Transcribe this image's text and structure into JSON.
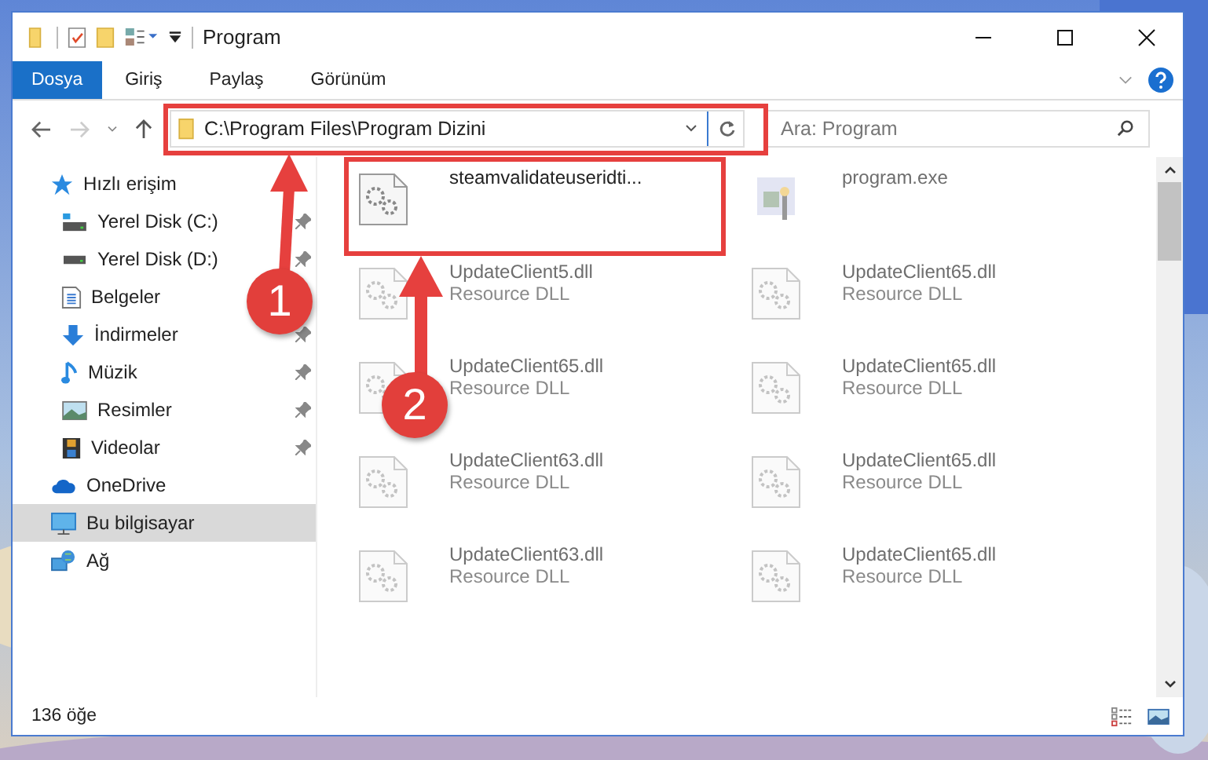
{
  "window": {
    "title": "Program"
  },
  "ribbon_tabs": [
    {
      "label": "Dosya",
      "selected": true
    },
    {
      "label": "Giriş",
      "selected": false
    },
    {
      "label": "Paylaş",
      "selected": false
    },
    {
      "label": "Görünüm",
      "selected": false
    }
  ],
  "address": {
    "path": "C:\\Program Files\\Program Dizini"
  },
  "search": {
    "placeholder": "Ara: Program"
  },
  "sidebar": {
    "items": [
      {
        "label": "Hızlı erişim",
        "selected": false,
        "children": [
          {
            "label": "Yerel Disk (C:)",
            "pinned": true
          },
          {
            "label": "Yerel Disk (D:)",
            "pinned": true
          },
          {
            "label": "Belgeler",
            "pinned": false
          },
          {
            "label": "İndirmeler",
            "pinned": true
          },
          {
            "label": "Müzik",
            "pinned": true
          },
          {
            "label": "Resimler",
            "pinned": true
          },
          {
            "label": "Videolar",
            "pinned": true
          }
        ]
      },
      {
        "label": "OneDrive",
        "selected": false
      },
      {
        "label": "Bu bilgisayar",
        "selected": true
      },
      {
        "label": "Ağ",
        "selected": false
      }
    ]
  },
  "files": [
    {
      "name": "steamvalidateuseridti...",
      "kind": "settings",
      "dimmed": false
    },
    {
      "name": "program.exe",
      "kind": "app",
      "dimmed": true
    },
    {
      "name": "UpdateClient5.dll",
      "type": "Resource DLL",
      "kind": "settings",
      "dimmed": true
    },
    {
      "name": "UpdateClient65.dll",
      "type": "Resource DLL",
      "kind": "settings",
      "dimmed": true
    },
    {
      "name": "UpdateClient65.dll",
      "type": "Resource DLL",
      "kind": "settings",
      "dimmed": true
    },
    {
      "name": "UpdateClient65.dll",
      "type": "Resource DLL",
      "kind": "settings",
      "dimmed": true
    },
    {
      "name": "UpdateClient63.dll",
      "type": "Resource DLL",
      "kind": "settings",
      "dimmed": true
    },
    {
      "name": "UpdateClient65.dll",
      "type": "Resource DLL",
      "kind": "settings",
      "dimmed": true
    },
    {
      "name": "UpdateClient63.dll",
      "type": "Resource DLL",
      "kind": "settings",
      "dimmed": true
    },
    {
      "name": "UpdateClient65.dll",
      "type": "Resource DLL",
      "kind": "settings",
      "dimmed": true
    }
  ],
  "annotations": [
    {
      "number": "1"
    },
    {
      "number": "2"
    }
  ],
  "status_bar": {
    "item_count": "136 öğe"
  }
}
